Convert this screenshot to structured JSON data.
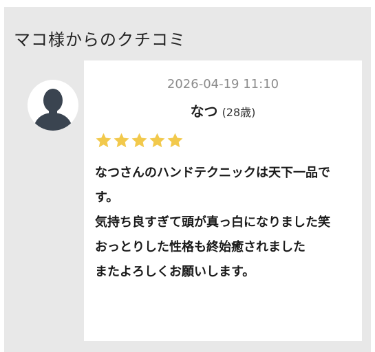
{
  "section": {
    "title": "マコ様からのクチコミ"
  },
  "review": {
    "date": "2026-04-19 11:10",
    "reviewer_name": "なつ",
    "reviewer_age": "(28歳)",
    "rating": 5,
    "rating_max": 5,
    "star_color": "#f2c94c",
    "avatar_icon": "user-silhouette-icon",
    "lines": [
      "なつさんのハンドテクニックは天下一品です。",
      "気持ち良すぎて頭が真っ白になりました笑",
      "おっとりした性格も終始癒されました",
      "またよろしくお願いします。"
    ]
  },
  "colors": {
    "panel_background": "#e8e8e8",
    "card_background": "#ffffff",
    "avatar_fill": "#3a4450"
  }
}
